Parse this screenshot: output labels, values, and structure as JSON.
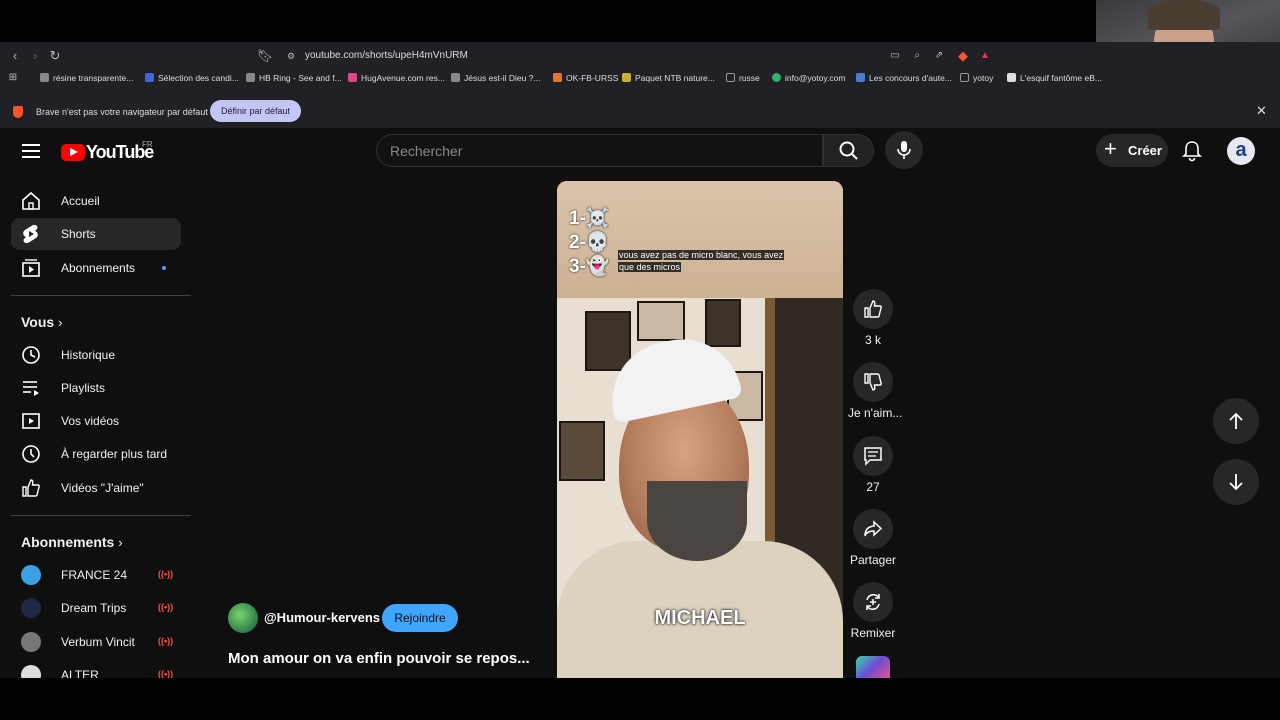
{
  "browser": {
    "url": "youtube.com/shorts/upeH4mVnURM",
    "bookmarks": [
      {
        "label": "résine transparente...",
        "color": "#888888"
      },
      {
        "label": "Sélection des candi...",
        "color": "#3b6ad8"
      },
      {
        "label": "HB Ring - See and f...",
        "color": "#888888"
      },
      {
        "label": "HugAvenue.com res...",
        "color": "#e0478a"
      },
      {
        "label": "Jésus est-il Dieu ?...",
        "color": "#888888"
      },
      {
        "label": "OK-FB-URSS",
        "color": "#e8742c"
      },
      {
        "label": "Paquet NTB nature...",
        "color": "#c8b13a"
      },
      {
        "label": "russe",
        "color": "#999999"
      },
      {
        "label": "info@yotoy.com",
        "color": "#2fb36e"
      },
      {
        "label": "Les concours d'aute...",
        "color": "#4a7bd0"
      },
      {
        "label": "yotoy",
        "color": "#999999"
      },
      {
        "label": "L'esquif fantôme eB...",
        "color": "#dddddd"
      }
    ],
    "notice_text": "Brave n'est pas votre navigateur par défaut",
    "notice_button": "Définir par défaut"
  },
  "header": {
    "logo_text": "YouTube",
    "region": "FR",
    "search_placeholder": "Rechercher",
    "create_label": "Créer",
    "avatar_letter": "a"
  },
  "sidebar": {
    "main": [
      {
        "label": "Accueil",
        "icon": "home-icon"
      },
      {
        "label": "Shorts",
        "icon": "shorts-icon"
      },
      {
        "label": "Abonnements",
        "icon": "subscriptions-icon"
      }
    ],
    "you_heading": "Vous",
    "you": [
      {
        "label": "Historique",
        "icon": "history-icon"
      },
      {
        "label": "Playlists",
        "icon": "playlists-icon"
      },
      {
        "label": "Vos vidéos",
        "icon": "your-videos-icon"
      },
      {
        "label": "À regarder plus tard",
        "icon": "watch-later-icon"
      },
      {
        "label": "Vidéos \"J'aime\"",
        "icon": "liked-videos-icon"
      }
    ],
    "subs_heading": "Abonnements",
    "subs": [
      {
        "label": "FRANCE 24",
        "color": "#3ba1e0"
      },
      {
        "label": "Dream Trips",
        "color": "#1c2a44"
      },
      {
        "label": "Verbum Vincit",
        "color": "#777777"
      },
      {
        "label": "ALTER",
        "color": "#dddddd"
      }
    ]
  },
  "short": {
    "overlay_lines": [
      "1-☠️",
      "2-💀",
      "3-👻"
    ],
    "caption_line1": "vous avez pas de micro blanc, vous avez",
    "caption_line2": "que des micros",
    "name_overlay": "MICHAEL",
    "channel": "@Humour-kervens",
    "join_label": "Rejoindre",
    "title": "Mon amour on va enfin pouvoir se repos..."
  },
  "actions": {
    "likes": "3 k",
    "dislike": "Je n'aim...",
    "comments": "27",
    "share": "Partager",
    "remix": "Remixer"
  }
}
